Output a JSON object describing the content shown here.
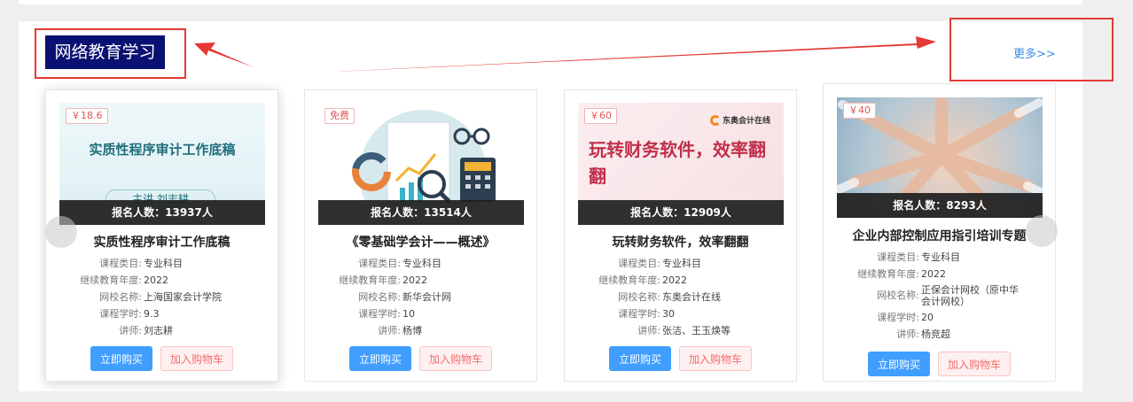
{
  "section": {
    "title": "网络教育学习",
    "more_label": "更多>>"
  },
  "colors": {
    "accent": "#409eff",
    "title_bg": "#0a1172",
    "annotation": "#e53935",
    "price_text": "#e25757"
  },
  "labels": {
    "category": "课程类目:",
    "year": "继续教育年度:",
    "school": "网校名称:",
    "hours": "课程学时:",
    "teacher": "讲师:",
    "buy": "立即购买",
    "cart": "加入购物车"
  },
  "courses": [
    {
      "price": "￥18.6",
      "enroll": "报名人数：13937人",
      "name": "实质性程序审计工作底稿",
      "thumb_title": "实质性程序审计工作底稿",
      "thumb_sub": "主讲  刘志耕",
      "category": "专业科目",
      "year": "2022",
      "school": "上海国家会计学院",
      "hours": "9.3",
      "teacher": "刘志耕"
    },
    {
      "price": "免费",
      "enroll": "报名人数：13514人",
      "name": "《零基础学会计——概述》",
      "category": "专业科目",
      "year": "2022",
      "school": "新华会计网",
      "hours": "10",
      "teacher": "杨博"
    },
    {
      "price": "￥60",
      "enroll": "报名人数：12909人",
      "name": "玩转财务软件，效率翻翻",
      "thumb_title": "玩转财务软件，效率翻翻",
      "thumb_brand": "东奥会计在线",
      "category": "专业科目",
      "year": "2022",
      "school": "东奥会计在线",
      "hours": "30",
      "teacher": "张洁、王玉焕等"
    },
    {
      "price": "￥40",
      "enroll": "报名人数：8293人",
      "name": "企业内部控制应用指引培训专题",
      "category": "专业科目",
      "year": "2022",
      "school": "正保会计网校（原中华会计网校）",
      "hours": "20",
      "teacher": "杨竞超"
    }
  ]
}
